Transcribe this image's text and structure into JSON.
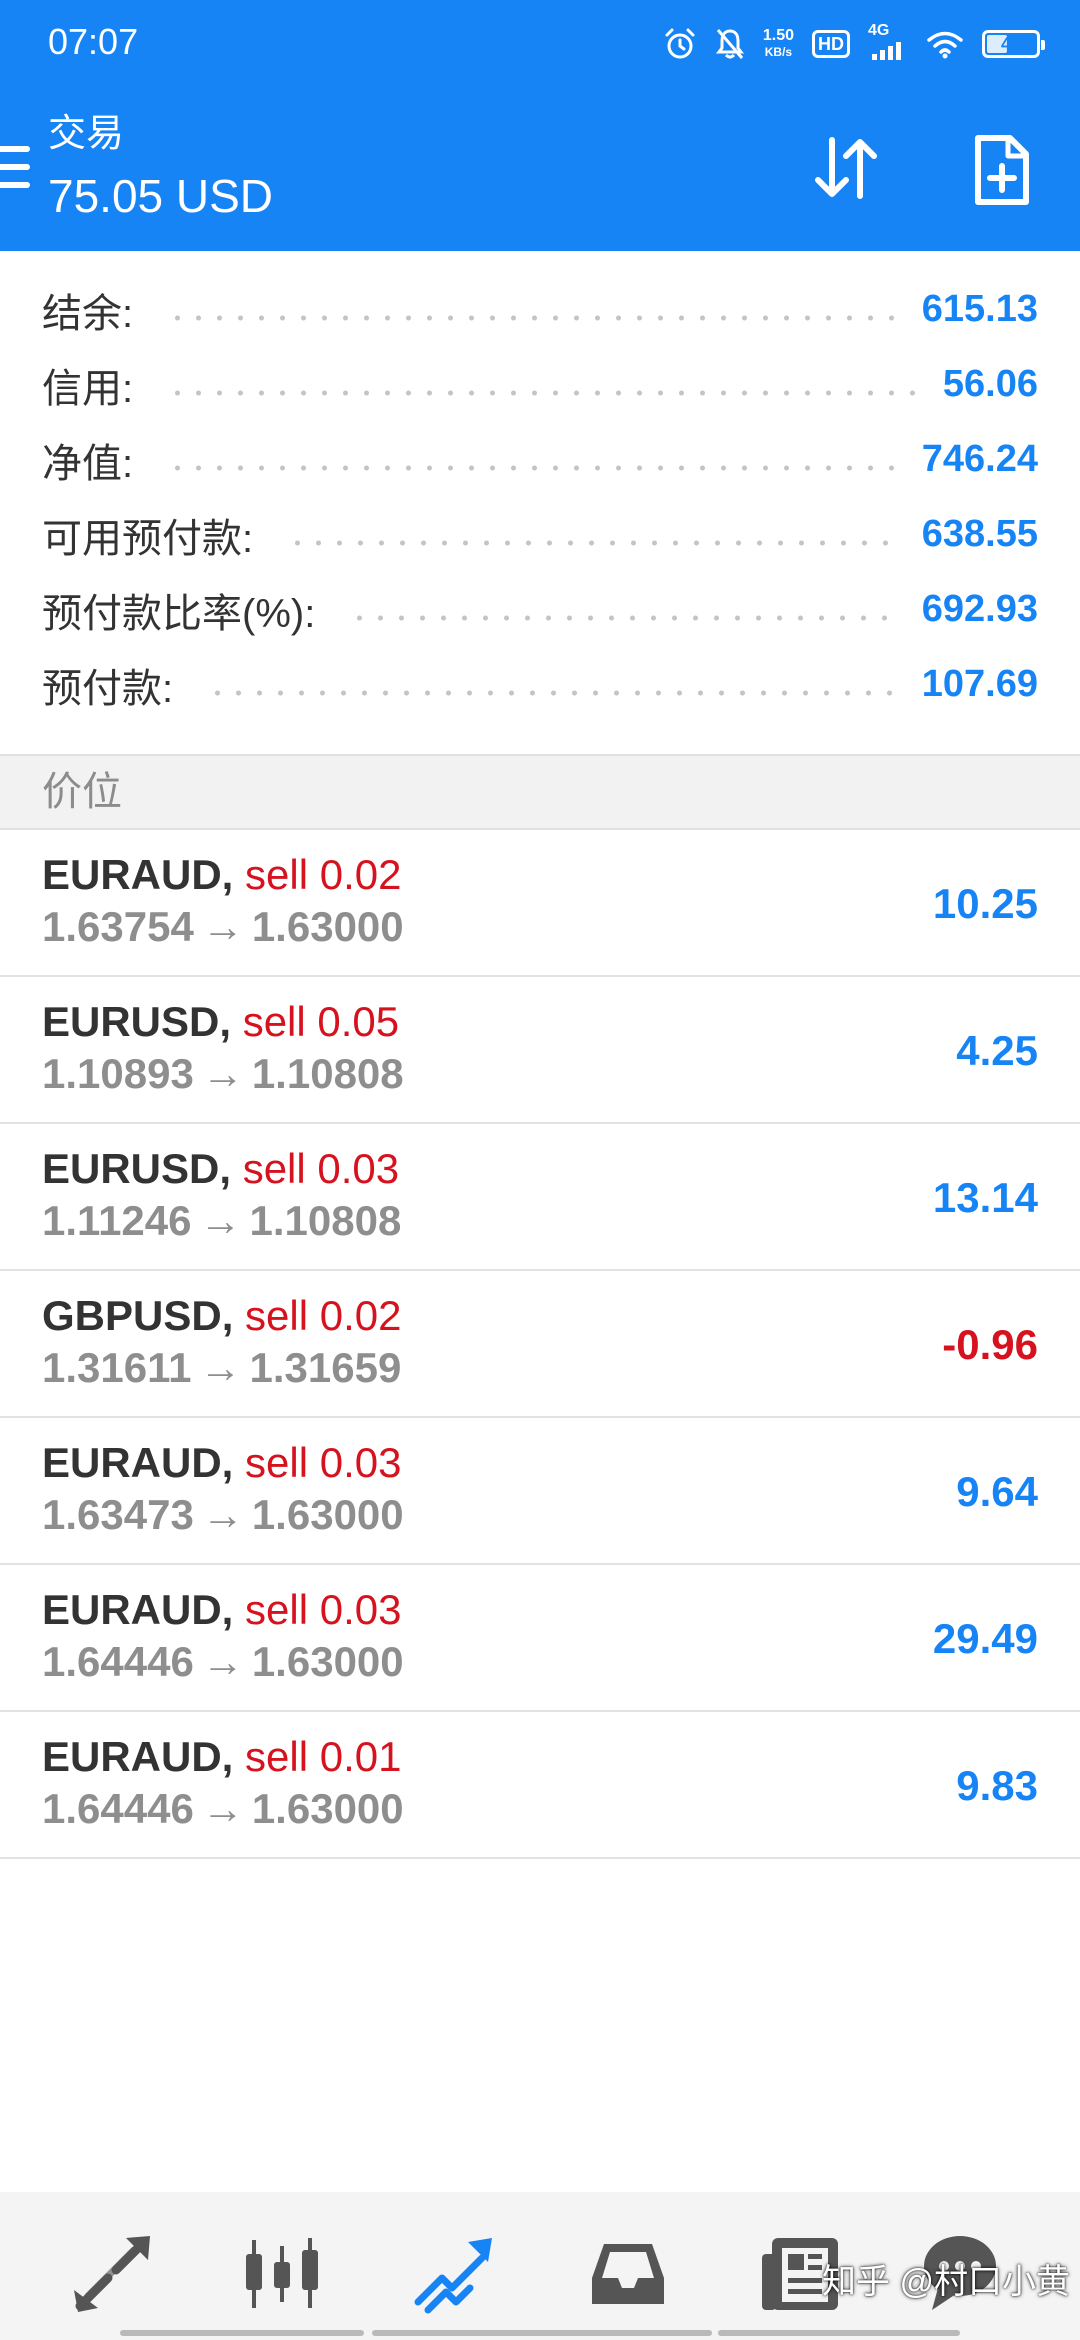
{
  "status_bar": {
    "time": "07:07",
    "net_speed_value": "1.50",
    "net_speed_unit": "KB/s",
    "hd_label": "HD",
    "network_label": "4G",
    "battery_level": "46",
    "icons": [
      "alarm-icon",
      "notifications-off-icon",
      "wifi-icon",
      "battery-icon"
    ]
  },
  "header": {
    "title": "交易",
    "balance": "75.05 USD",
    "icons": [
      "menu-icon",
      "sort-arrows-icon",
      "new-order-icon"
    ]
  },
  "summary": [
    {
      "label": "结余:",
      "value": "615.13"
    },
    {
      "label": "信用:",
      "value": "56.06"
    },
    {
      "label": "净值:",
      "value": "746.24"
    },
    {
      "label": "可用预付款:",
      "value": "638.55"
    },
    {
      "label": "预付款比率(%):",
      "value": "692.93"
    },
    {
      "label": "预付款:",
      "value": "107.69"
    }
  ],
  "section": {
    "title": "价位"
  },
  "positions": [
    {
      "symbol": "EURAUD",
      "comma": ",",
      "side": "sell",
      "volume": "0.02",
      "open_price": "1.63754",
      "arrow": "→",
      "current_price": "1.63000",
      "profit": "10.25",
      "negative": false
    },
    {
      "symbol": "EURUSD",
      "comma": ",",
      "side": "sell",
      "volume": "0.05",
      "open_price": "1.10893",
      "arrow": "→",
      "current_price": "1.10808",
      "profit": "4.25",
      "negative": false
    },
    {
      "symbol": "EURUSD",
      "comma": ",",
      "side": "sell",
      "volume": "0.03",
      "open_price": "1.11246",
      "arrow": "→",
      "current_price": "1.10808",
      "profit": "13.14",
      "negative": false
    },
    {
      "symbol": "GBPUSD",
      "comma": ",",
      "side": "sell",
      "volume": "0.02",
      "open_price": "1.31611",
      "arrow": "→",
      "current_price": "1.31659",
      "profit": "-0.96",
      "negative": true
    },
    {
      "symbol": "EURAUD",
      "comma": ",",
      "side": "sell",
      "volume": "0.03",
      "open_price": "1.63473",
      "arrow": "→",
      "current_price": "1.63000",
      "profit": "9.64",
      "negative": false
    },
    {
      "symbol": "EURAUD",
      "comma": ",",
      "side": "sell",
      "volume": "0.03",
      "open_price": "1.64446",
      "arrow": "→",
      "current_price": "1.63000",
      "profit": "29.49",
      "negative": false
    },
    {
      "symbol": "EURAUD",
      "comma": ",",
      "side": "sell",
      "volume": "0.01",
      "open_price": "1.64446",
      "arrow": "→",
      "current_price": "1.63000",
      "profit": "9.83",
      "negative": false
    }
  ],
  "bottom_nav": {
    "items": [
      {
        "icon": "quotes-arrows-icon",
        "active": false
      },
      {
        "icon": "candlestick-chart-icon",
        "active": true
      },
      {
        "icon": "trade-trend-icon",
        "active": true
      },
      {
        "icon": "inbox-tray-icon",
        "active": false
      },
      {
        "icon": "news-icon",
        "active": false
      },
      {
        "icon": "chat-icon",
        "active": false
      }
    ],
    "watermark": "知乎 @村口小黄"
  },
  "colors": {
    "header_blue": "#1784f5",
    "profit_blue": "#1784f5",
    "loss_red": "#d6121e",
    "sell_red": "#d6121e",
    "muted_gray": "#8e8e8e",
    "nav_active": "#1784f5",
    "nav_inactive": "#555555"
  }
}
